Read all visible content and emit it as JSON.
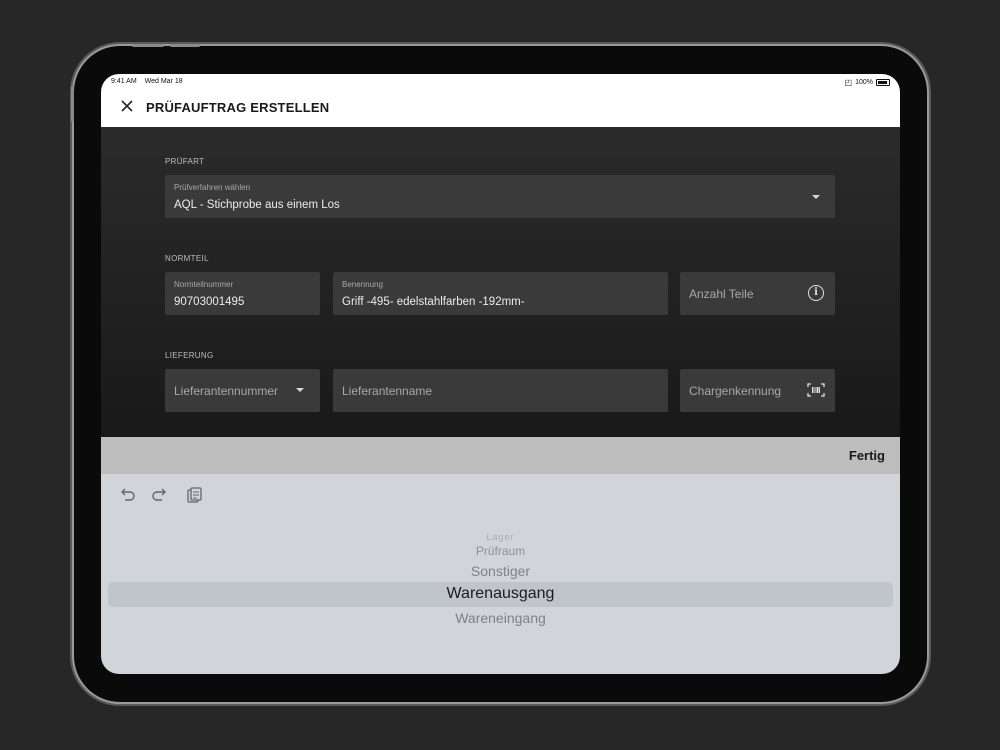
{
  "status": {
    "time": "9:41 AM",
    "date": "Wed Mar 18",
    "battery": "100%"
  },
  "header": {
    "title": "PRÜFAUFTRAG ERSTELLEN",
    "close_icon": "close-icon"
  },
  "sections": {
    "prufart": {
      "label": "PRÜFART",
      "field": {
        "label": "Prüfverfahren wählen",
        "value": "AQL - Stichprobe aus einem Los"
      }
    },
    "normteil": {
      "label": "NORMTEIL",
      "number": {
        "label": "Normteilnummer",
        "value": "90703001495"
      },
      "name": {
        "label": "Benennung",
        "value": "Griff -495- edelstahlfarben -192mm-"
      },
      "count": {
        "placeholder": "Anzahl Teile",
        "icon": "info-icon"
      }
    },
    "lieferung": {
      "label": "LIEFERUNG",
      "supplier_number": {
        "placeholder": "Lieferantennummer"
      },
      "supplier_name": {
        "placeholder": "Lieferantenname"
      },
      "batch": {
        "placeholder": "Chargenkennung",
        "icon": "barcode-icon"
      }
    }
  },
  "picker": {
    "done_label": "Fertig",
    "items": [
      "Lager",
      "Prüfraum",
      "Sonstiger",
      "Warenausgang",
      "Wareneingang"
    ],
    "selected": "Warenausgang"
  },
  "colors": {
    "form_bg": "#2b2b2b",
    "field_bg": "#3a3a3a",
    "picker_bg": "#d1d4d9"
  }
}
